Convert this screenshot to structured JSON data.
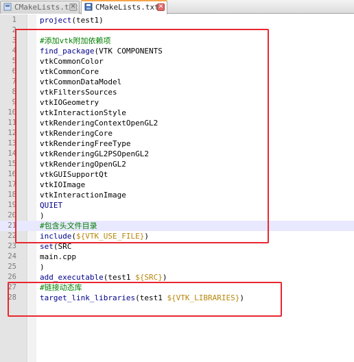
{
  "tabs": [
    {
      "label": "CMakeLists.txt",
      "active": false
    },
    {
      "label": "CMakeLists.txt",
      "active": true
    }
  ],
  "editor": {
    "current_line": 21,
    "lines": [
      {
        "n": "1",
        "tokens": [
          {
            "t": "project",
            "c": "kw"
          },
          {
            "t": "(test1)",
            "c": ""
          }
        ]
      },
      {
        "n": "2",
        "tokens": []
      },
      {
        "n": "3",
        "tokens": [
          {
            "t": "#添加vtk附加依赖项",
            "c": "cmt"
          }
        ]
      },
      {
        "n": "4",
        "tokens": [
          {
            "t": "find_package",
            "c": "kw"
          },
          {
            "t": "(VTK COMPONENTS",
            "c": ""
          }
        ]
      },
      {
        "n": "5",
        "tokens": [
          {
            "t": "vtkCommonColor",
            "c": ""
          }
        ]
      },
      {
        "n": "6",
        "tokens": [
          {
            "t": "vtkCommonCore",
            "c": ""
          }
        ]
      },
      {
        "n": "7",
        "tokens": [
          {
            "t": "vtkCommonDataModel",
            "c": ""
          }
        ]
      },
      {
        "n": "8",
        "tokens": [
          {
            "t": "vtkFiltersSources",
            "c": ""
          }
        ]
      },
      {
        "n": "9",
        "tokens": [
          {
            "t": "vtkIOGeometry",
            "c": ""
          }
        ]
      },
      {
        "n": "10",
        "tokens": [
          {
            "t": "vtkInteractionStyle",
            "c": ""
          }
        ]
      },
      {
        "n": "11",
        "tokens": [
          {
            "t": "vtkRenderingContextOpenGL2",
            "c": ""
          }
        ]
      },
      {
        "n": "12",
        "tokens": [
          {
            "t": "vtkRenderingCore",
            "c": ""
          }
        ]
      },
      {
        "n": "13",
        "tokens": [
          {
            "t": "vtkRenderingFreeType",
            "c": ""
          }
        ]
      },
      {
        "n": "14",
        "tokens": [
          {
            "t": "vtkRenderingGL2PSOpenGL2",
            "c": ""
          }
        ]
      },
      {
        "n": "15",
        "tokens": [
          {
            "t": "vtkRenderingOpenGL2",
            "c": ""
          }
        ]
      },
      {
        "n": "16",
        "tokens": [
          {
            "t": "vtkGUISupportQt",
            "c": ""
          }
        ]
      },
      {
        "n": "17",
        "tokens": [
          {
            "t": "vtkIOImage",
            "c": ""
          }
        ]
      },
      {
        "n": "18",
        "tokens": [
          {
            "t": "vtkInteractionImage",
            "c": ""
          }
        ]
      },
      {
        "n": "19",
        "tokens": [
          {
            "t": "QUIET",
            "c": "kw"
          }
        ]
      },
      {
        "n": "20",
        "tokens": [
          {
            "t": ")",
            "c": ""
          }
        ]
      },
      {
        "n": "21",
        "tokens": [
          {
            "t": "#包含头文件目录",
            "c": "cmt"
          }
        ]
      },
      {
        "n": "22",
        "tokens": [
          {
            "t": "include",
            "c": "kw"
          },
          {
            "t": "(",
            "c": ""
          },
          {
            "t": "${VTK_USE_FILE}",
            "c": "var"
          },
          {
            "t": ")",
            "c": ""
          }
        ]
      },
      {
        "n": "23",
        "tokens": [
          {
            "t": "set",
            "c": "kw"
          },
          {
            "t": "(SRC",
            "c": ""
          }
        ]
      },
      {
        "n": "24",
        "tokens": [
          {
            "t": "main.cpp",
            "c": ""
          }
        ]
      },
      {
        "n": "25",
        "tokens": [
          {
            "t": ")",
            "c": ""
          }
        ]
      },
      {
        "n": "26",
        "tokens": [
          {
            "t": "add_executable",
            "c": "kw"
          },
          {
            "t": "(test1 ",
            "c": ""
          },
          {
            "t": "${SRC}",
            "c": "var"
          },
          {
            "t": ")",
            "c": ""
          }
        ]
      },
      {
        "n": "27",
        "tokens": [
          {
            "t": "#链接动态库",
            "c": "cmt"
          }
        ]
      },
      {
        "n": "28",
        "tokens": [
          {
            "t": "target_link_libraries",
            "c": "kw"
          },
          {
            "t": "(test1 ",
            "c": ""
          },
          {
            "t": "${VTK_LIBRARIES}",
            "c": "var"
          },
          {
            "t": ")",
            "c": ""
          }
        ]
      }
    ]
  },
  "colors": {
    "keyword": "#00008b",
    "variable": "#b8860b",
    "comment": "#008000",
    "annotation": "#e8262f",
    "current_line": "#e8e8ff"
  }
}
